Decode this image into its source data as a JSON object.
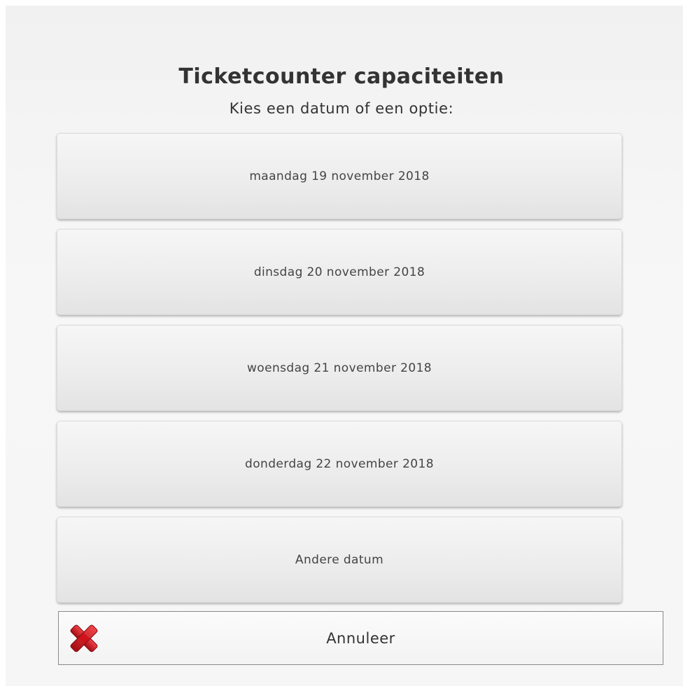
{
  "dialog": {
    "title": "Ticketcounter capaciteiten",
    "subtitle": "Kies een datum of een optie:"
  },
  "options": [
    {
      "label": "maandag 19 november 2018"
    },
    {
      "label": "dinsdag 20 november 2018"
    },
    {
      "label": "woensdag 21 november 2018"
    },
    {
      "label": "donderdag 22 november 2018"
    },
    {
      "label": "Andere datum"
    }
  ],
  "cancel": {
    "label": "Annuleer",
    "icon": "close-icon"
  },
  "colors": {
    "cancel_icon": "#d0121b",
    "background": "#f4f4f4",
    "text": "#333333"
  }
}
